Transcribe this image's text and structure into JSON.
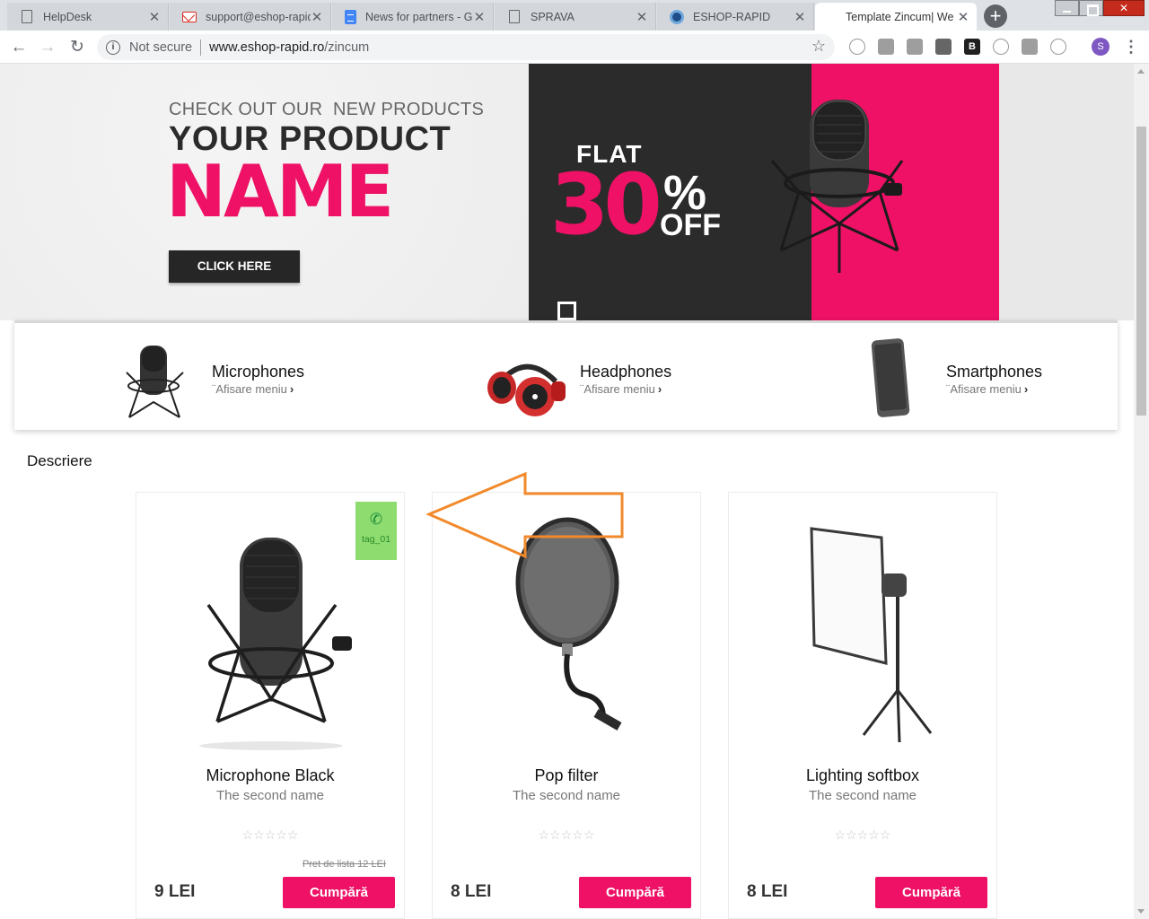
{
  "browser": {
    "tabs": [
      {
        "title": "HelpDesk",
        "icon": "page-icon"
      },
      {
        "title": "support@eshop-rapid",
        "icon": "gmail-icon"
      },
      {
        "title": "News for partners - G",
        "icon": "docs-icon"
      },
      {
        "title": "SPRAVA",
        "icon": "page-icon"
      },
      {
        "title": "ESHOP-RAPID",
        "icon": "eshop-icon"
      },
      {
        "title": "Template Zincum| We",
        "icon": "none"
      }
    ],
    "security": "Not secure",
    "url_host": "www.eshop-rapid.ro",
    "url_path": "/zincum",
    "profile_initial": "S"
  },
  "hero": {
    "kicker": "CHECK OUT OUR  NEW PRODUCTS",
    "line1": "YOUR PRODUCT",
    "line2": "NAME",
    "cta": "CLICK HERE",
    "flat": "FLAT",
    "discount": "30",
    "percent": "%",
    "off": "OFF",
    "colors": {
      "accent": "#ee1166",
      "dark": "#2c2b2c"
    }
  },
  "categories": [
    {
      "name": "Microphones",
      "link": "¨Afisare meniu"
    },
    {
      "name": "Headphones",
      "link": "¨Afisare meniu"
    },
    {
      "name": "Smartphones",
      "link": "¨Afisare meniu"
    }
  ],
  "section_title": "Descriere",
  "products": [
    {
      "name": "Microphone Black",
      "subtitle": "The second name",
      "stars": "☆☆☆☆☆",
      "list_price": "Pret de lista 12 LEI",
      "price": "9 LEI",
      "buy": "Cumpără",
      "tag": "tag_01"
    },
    {
      "name": "Pop filter",
      "subtitle": "The second name",
      "stars": "☆☆☆☆☆",
      "list_price": "",
      "price": "8 LEI",
      "buy": "Cumpără",
      "tag": ""
    },
    {
      "name": "Lighting softbox",
      "subtitle": "The second name",
      "stars": "☆☆☆☆☆",
      "list_price": "",
      "price": "8 LEI",
      "buy": "Cumpără",
      "tag": ""
    }
  ]
}
